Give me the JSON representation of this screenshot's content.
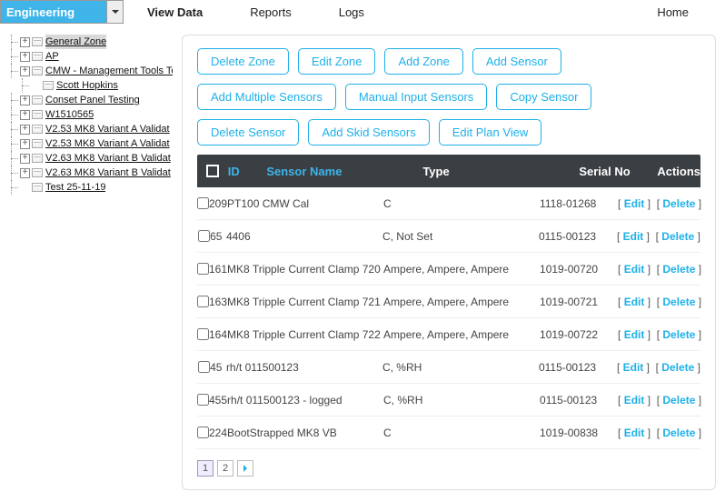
{
  "dropdown": {
    "selected": "Engineering"
  },
  "topnav": {
    "items": [
      {
        "label": "View Data",
        "active": true
      },
      {
        "label": "Reports",
        "active": false
      },
      {
        "label": "Logs",
        "active": false
      }
    ],
    "home": "Home"
  },
  "tree": [
    {
      "label": "General Zone",
      "expandable": true,
      "depth": 0,
      "selected": true
    },
    {
      "label": "AP",
      "expandable": true,
      "depth": 0
    },
    {
      "label": "CMW - Management Tools Te",
      "expandable": true,
      "depth": 0
    },
    {
      "label": "Scott Hopkins",
      "expandable": false,
      "depth": 1
    },
    {
      "label": "Conset Panel Testing",
      "expandable": true,
      "depth": 0
    },
    {
      "label": "W1510565",
      "expandable": true,
      "depth": 0
    },
    {
      "label": "V2.53 MK8 Variant A Validat",
      "expandable": true,
      "depth": 0
    },
    {
      "label": "V2.53 MK8 Variant A Validat",
      "expandable": true,
      "depth": 0
    },
    {
      "label": "V2.63 MK8 Variant B Validat",
      "expandable": true,
      "depth": 0
    },
    {
      "label": "V2.63 MK8 Variant B Validat",
      "expandable": true,
      "depth": 0
    },
    {
      "label": "Test 25-11-19",
      "expandable": false,
      "depth": 0
    }
  ],
  "actions": [
    "Delete Zone",
    "Edit Zone",
    "Add Zone",
    "Add Sensor",
    "Add Multiple Sensors",
    "Manual Input Sensors",
    "Copy Sensor",
    "Delete Sensor",
    "Add Skid Sensors",
    "Edit Plan View"
  ],
  "table": {
    "headers": {
      "id": "ID",
      "name": "Sensor Name",
      "type": "Type",
      "serial": "Serial No",
      "actions": "Actions"
    },
    "rows": [
      {
        "id": "209",
        "name": "PT100 CMW Cal",
        "type": "C",
        "serial": "1118-01268"
      },
      {
        "id": "65",
        "name": "4406",
        "type": "C, Not Set",
        "serial": "0115-00123"
      },
      {
        "id": "161",
        "name": "MK8 Tripple Current Clamp 720",
        "type": "Ampere, Ampere, Ampere",
        "serial": "1019-00720"
      },
      {
        "id": "163",
        "name": "MK8 Tripple Current Clamp 721",
        "type": "Ampere, Ampere, Ampere",
        "serial": "1019-00721"
      },
      {
        "id": "164",
        "name": "MK8 Tripple Current Clamp 722",
        "type": "Ampere, Ampere, Ampere",
        "serial": "1019-00722"
      },
      {
        "id": "45",
        "name": "rh/t 011500123",
        "type": "C, %RH",
        "serial": "0115-00123"
      },
      {
        "id": "455",
        "name": "rh/t 011500123 - logged",
        "type": "C, %RH",
        "serial": "0115-00123"
      },
      {
        "id": "224",
        "name": "BootStrapped MK8 VB",
        "type": "C",
        "serial": "1019-00838"
      }
    ],
    "row_actions": {
      "edit": "Edit",
      "delete": "Delete"
    }
  },
  "pager": {
    "pages": [
      "1",
      "2"
    ],
    "current": 0
  }
}
